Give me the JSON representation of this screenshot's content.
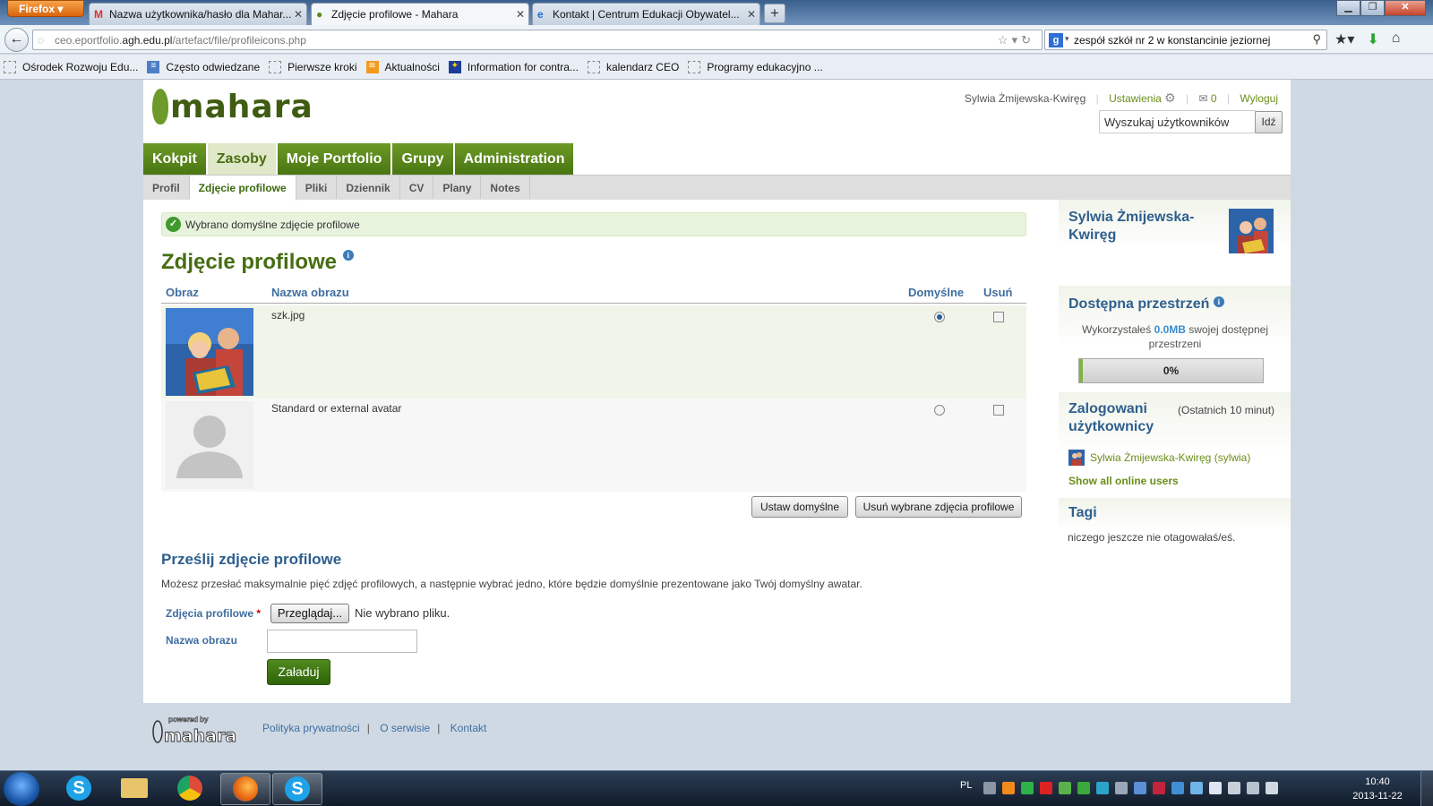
{
  "browser": {
    "menu_button": "Firefox",
    "tabs": [
      {
        "label": "Nazwa użytkownika/hasło dla Mahar...",
        "icon": "gmail-icon"
      },
      {
        "label": "Zdjęcie profilowe - Mahara",
        "icon": "mahara-icon",
        "active": true
      },
      {
        "label": "Kontakt | Centrum Edukacji Obywatel...",
        "icon": "ie-icon"
      }
    ],
    "url_prefix": "ceo.eportfolio.",
    "url_domain": "agh.edu.pl",
    "url_path": "/artefact/file/profileicons.php",
    "search_text": "zespół szkół nr 2 w konstancinie jeziornej",
    "bookmarks": [
      "Ośrodek Rozwoju Edu...",
      "Często odwiedzane",
      "Pierwsze kroki",
      "Aktualności",
      "Information for contra...",
      "kalendarz CEO",
      "Programy edukacyjno ..."
    ]
  },
  "header": {
    "user_name": "Sylwia Żmijewska-Kwiręg",
    "settings": "Ustawienia",
    "inbox_count": "0",
    "logout": "Wyloguj",
    "search_placeholder": "Wyszukaj użytkowników",
    "search_button": "Idź"
  },
  "main_nav": [
    "Kokpit",
    "Zasoby",
    "Moje Portfolio",
    "Grupy",
    "Administration"
  ],
  "sub_nav": [
    "Profil",
    "Zdjęcie profilowe",
    "Pliki",
    "Dziennik",
    "CV",
    "Plany",
    "Notes"
  ],
  "content": {
    "message": "Wybrano domyślne zdjęcie profilowe",
    "title": "Zdjęcie profilowe",
    "table_headers": [
      "Obraz",
      "Nazwa obrazu",
      "Domyślne",
      "Usuń"
    ],
    "rows": [
      {
        "name": "szk.jpg",
        "default": true
      },
      {
        "name": "Standard or external avatar",
        "default": false
      }
    ],
    "btn_set_default": "Ustaw domyślne",
    "btn_delete": "Usuń wybrane zdjęcia profilowe",
    "upload_title": "Prześlij zdjęcie profilowe",
    "upload_desc": "Możesz przesłać maksymalnie pięć zdjęć profilowych, a następnie wybrać jedno, które będzie domyślnie prezentowane jako Twój domyślny awatar.",
    "field_images": "Zdjęcia profilowe",
    "required_mark": "*",
    "browse": "Przeglądaj...",
    "no_file": "Nie wybrano pliku.",
    "field_name": "Nazwa obrazu",
    "upload_btn": "Załaduj"
  },
  "sidebar": {
    "user_name": "Sylwia Żmijewska-Kwiręg",
    "space_title": "Dostępna przestrzeń",
    "space_text_pre": "Wykorzystałeś",
    "space_used": "0.0MB",
    "space_text_post": "swojej dostępnej przestrzeni",
    "space_percent_label": "0%",
    "space_percent": 0,
    "online_title": "Zalogowani użytkownicy",
    "online_period": "(Ostatnich 10 minut)",
    "online_user": "Sylwia Żmijewska-Kwiręg (sylwia)",
    "show_all": "Show all online users",
    "tags_title": "Tagi",
    "tags_text": "niczego jeszcze nie otagowałaś/eś."
  },
  "footer": {
    "links": [
      "Polityka prywatności",
      "O serwisie",
      "Kontakt"
    ]
  },
  "taskbar": {
    "lang": "PL",
    "time": "10:40",
    "date": "2013-11-22"
  }
}
